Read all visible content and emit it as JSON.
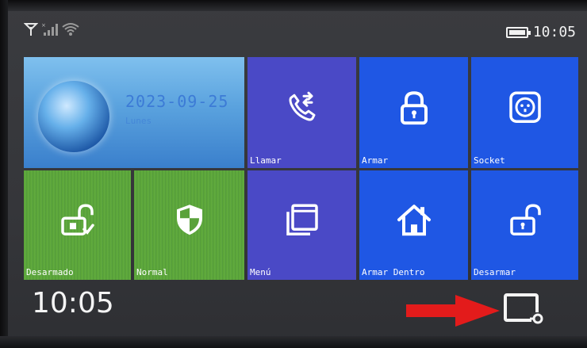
{
  "status": {
    "time": "10:05",
    "icons": [
      "antenna-icon",
      "signal-bars-icon",
      "wifi-icon",
      "battery-icon"
    ]
  },
  "date_tile": {
    "date": "2023-09-25",
    "day": "Lunes"
  },
  "tiles": [
    {
      "label": "Llamar",
      "icon": "phone-callback-icon",
      "color": "#4a49c6"
    },
    {
      "label": "Armar",
      "icon": "lock-closed-icon",
      "color": "#1f57e4"
    },
    {
      "label": "Socket",
      "icon": "power-socket-icon",
      "color": "#1f57e4"
    },
    {
      "label": "Desarmado",
      "icon": "unlock-check-icon",
      "color": "#5aa23a"
    },
    {
      "label": "Normal",
      "icon": "shield-icon",
      "color": "#5aa23a"
    },
    {
      "label": "Menú",
      "icon": "window-menu-icon",
      "color": "#4a49c6"
    },
    {
      "label": "Armar Dentro",
      "icon": "home-icon",
      "color": "#1f57e4"
    },
    {
      "label": "Desarmar",
      "icon": "lock-open-icon",
      "color": "#1f57e4"
    }
  ],
  "bottom": {
    "time": "10:05",
    "card_icon": "card-reader-icon",
    "annotation": "red-arrow-icon"
  },
  "colors": {
    "blue_tile": "#1f57e4",
    "purple_tile": "#4a49c6",
    "green_tile": "#5aa23a",
    "annotation_red": "#e31b1b"
  }
}
